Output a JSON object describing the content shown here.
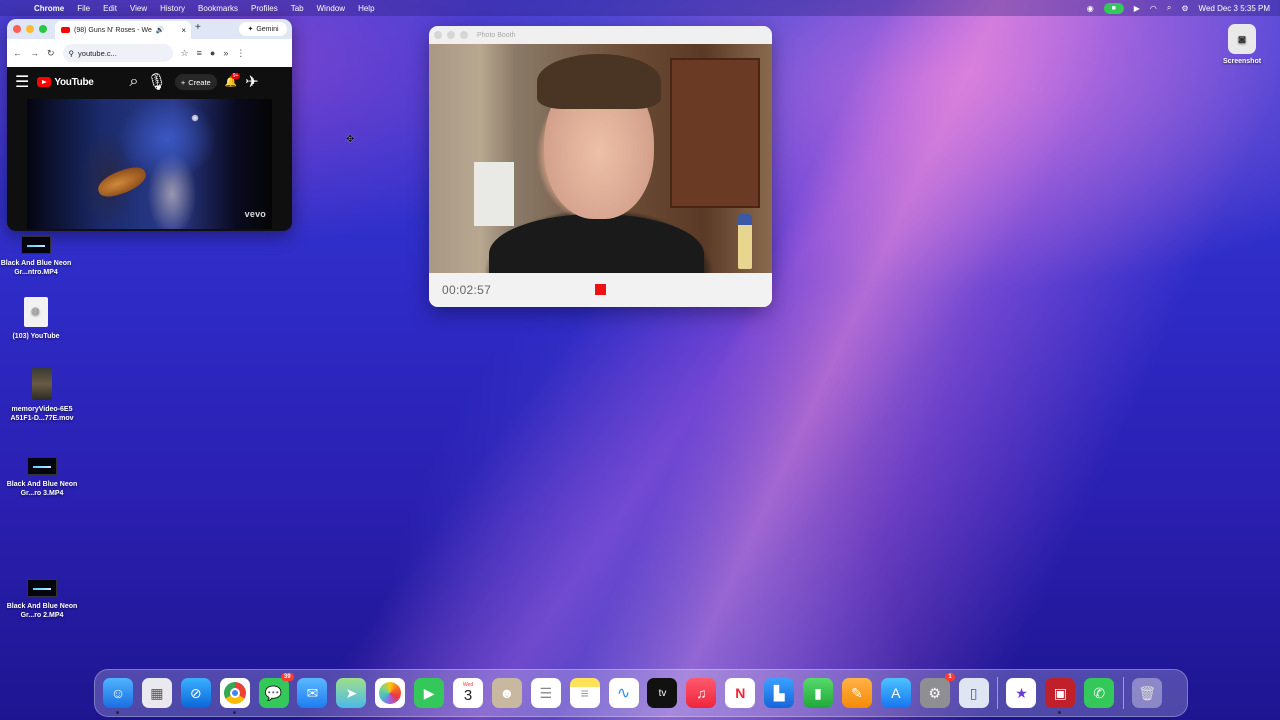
{
  "menubar": {
    "app_name": "Chrome",
    "items": [
      "File",
      "Edit",
      "View",
      "History",
      "Bookmarks",
      "Profiles",
      "Tab",
      "Window",
      "Help"
    ],
    "datetime": "Wed Dec 3  5:35 PM"
  },
  "chrome": {
    "tab_title": "(98) Guns N' Roses - We",
    "gemini_label": "Gemini",
    "url": "youtube.c...",
    "youtube": {
      "logo_text": "YouTube",
      "create_label": "Create",
      "notification_badge": "9+",
      "vevo_label": "vevo"
    }
  },
  "photo_booth": {
    "title": "Photo Booth",
    "timer": "00:02:57"
  },
  "desktop": {
    "icons": [
      {
        "label": "Black And Blue Neon Gr...ntro.MP4"
      },
      {
        "label": "(103) YouTube"
      },
      {
        "label": "memoryVideo-6E5 A51F1-D...77E.mov"
      },
      {
        "label": "Black And Blue Neon Gr...ro 3.MP4"
      },
      {
        "label": "Black And Blue Neon Gr...ro 2.MP4"
      }
    ],
    "screenshot_label": "Screenshot"
  },
  "dock": {
    "calendar_month": "Wed",
    "calendar_day": "3",
    "messages_badge": "39",
    "settings_badge": "1",
    "tv_label": "tv"
  }
}
